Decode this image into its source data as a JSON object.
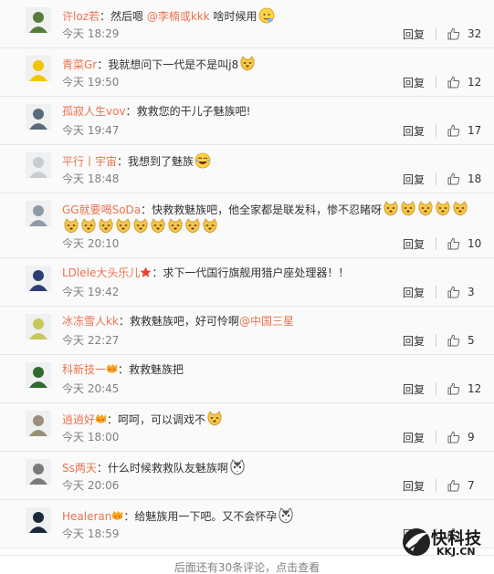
{
  "colors": {
    "username": "#eb7350",
    "text": "#333333",
    "meta": "#808080",
    "divider": "#e6e6e6"
  },
  "comments": [
    {
      "user": "许loz若",
      "body": "然后嗯  ",
      "mention": "@李楠或kkk",
      "after": " 啥时候用",
      "emoji_count": 1,
      "emoji_kind": "face",
      "time": "今天 18:29",
      "reply": "回复",
      "likes": "32"
    },
    {
      "user": "青菜Gr",
      "body": "我就想问下一代是不是叫j8",
      "emoji_count": 1,
      "emoji_kind": "doge",
      "time": "今天 19:50",
      "reply": "回复",
      "likes": "12"
    },
    {
      "user": "孤寂人生vov",
      "body": "救救您的干儿子魅族吧!",
      "time": "今天 19:47",
      "reply": "回复",
      "likes": "17"
    },
    {
      "user": "平行丨宇宙",
      "body": "我想到了魅族",
      "emoji_count": 1,
      "emoji_kind": "laugh",
      "time": "今天 18:48",
      "reply": "回复",
      "likes": "18"
    },
    {
      "user": "GG就要喝SoDa",
      "body": "快救救魅族吧，他全家都是联发科，惨不忍睹呀",
      "emoji_count": 5,
      "emoji_kind": "doge",
      "second_line_emoji": 9,
      "time": "今天 20:10",
      "reply": "回复",
      "likes": "10"
    },
    {
      "user": "LDlele大头乐儿",
      "badge": "star",
      "body": "求下一代国行旗舰用猎户座处理器！！",
      "time": "今天 19:42",
      "reply": "回复",
      "likes": "3"
    },
    {
      "user": "冰冻雪人kk",
      "body": "救救魅族吧，好可怜啊",
      "mention": "@中国三星",
      "time": "今天 22:27",
      "reply": "回复",
      "likes": "5"
    },
    {
      "user": "科新技一",
      "badge": "vip",
      "body": "救救魅族把",
      "time": "今天 20:45",
      "reply": "回复",
      "likes": "12"
    },
    {
      "user": "逍逍好",
      "badge": "vip",
      "body": "呵呵，可以调戏不",
      "emoji_count": 1,
      "emoji_kind": "doge",
      "time": "今天 18:00",
      "reply": "回复",
      "likes": "9"
    },
    {
      "user": "Ss两天",
      "body": "什么时候救救队友魅族啊",
      "emoji_count": 1,
      "emoji_kind": "husky",
      "time": "今天 20:06",
      "reply": "回复",
      "likes": "7"
    },
    {
      "user": "Healeran",
      "badge": "vip",
      "body": "给魅族用一下吧。又不会怀孕",
      "emoji_count": 1,
      "emoji_kind": "husky",
      "time": "今天 18:59",
      "reply": "回复",
      "likes": ""
    }
  ],
  "footer": {
    "more_text": "后面还有30条评论，点击查看"
  },
  "watermark": {
    "title": "快科技",
    "url": "KKJ.CN"
  }
}
